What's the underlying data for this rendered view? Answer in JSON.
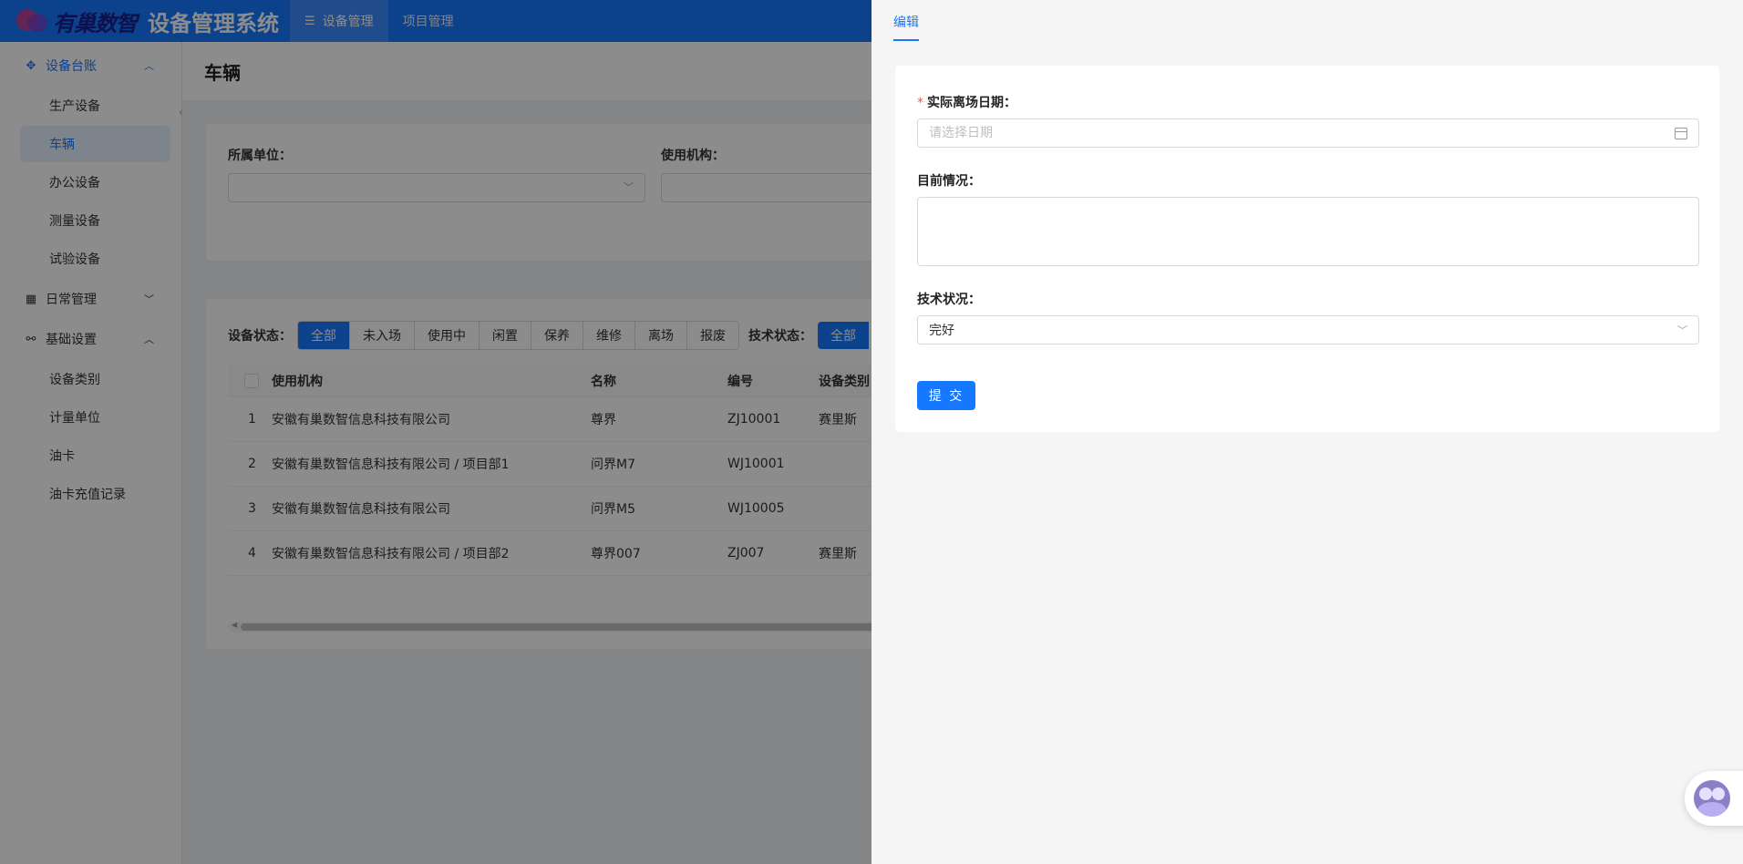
{
  "header": {
    "logo_text": "有巢数智",
    "app_title": "设备管理系统",
    "tabs": [
      {
        "label": "设备管理",
        "icon": "list-icon",
        "active": true
      },
      {
        "label": "项目管理",
        "active": false
      }
    ]
  },
  "sidebar": {
    "groups": [
      {
        "label": "设备台账",
        "icon": "cluster-icon",
        "expanded": true,
        "items": [
          {
            "label": "生产设备"
          },
          {
            "label": "车辆",
            "active": true
          },
          {
            "label": "办公设备"
          },
          {
            "label": "测量设备"
          },
          {
            "label": "试验设备"
          }
        ]
      },
      {
        "label": "日常管理",
        "icon": "dashboard-icon",
        "expanded": false
      },
      {
        "label": "基础设置",
        "icon": "link-icon",
        "expanded": true,
        "items": [
          {
            "label": "设备类别"
          },
          {
            "label": "计量单位"
          },
          {
            "label": "油卡"
          },
          {
            "label": "油卡充值记录"
          }
        ]
      }
    ]
  },
  "page": {
    "title": "车辆",
    "filters": {
      "unit_label": "所属单位：",
      "org_label": "使用机构："
    },
    "status_label": "设备状态：",
    "status_options": [
      "全部",
      "未入场",
      "使用中",
      "闲置",
      "保养",
      "维修",
      "离场",
      "报废"
    ],
    "tech_label": "技术状态：",
    "tech_first_option": "全部",
    "table": {
      "columns": [
        "使用机构",
        "名称",
        "编号",
        "设备类别"
      ],
      "rows": [
        {
          "idx": "1",
          "org": "安徽有巢数智信息科技有限公司",
          "name": "尊界",
          "code": "ZJ10001",
          "type": "赛里斯"
        },
        {
          "idx": "2",
          "org": "安徽有巢数智信息科技有限公司 / 项目部1",
          "name": "问界M7",
          "code": "WJ10001",
          "type": ""
        },
        {
          "idx": "3",
          "org": "安徽有巢数智信息科技有限公司",
          "name": "问界M5",
          "code": "WJ10005",
          "type": ""
        },
        {
          "idx": "4",
          "org": "安徽有巢数智信息科技有限公司 / 项目部2",
          "name": "尊界007",
          "code": "ZJ007",
          "type": "赛里斯"
        }
      ]
    }
  },
  "drawer": {
    "tab_label": "编辑",
    "form": {
      "date_label": "实际离场日期：",
      "date_required": "*",
      "date_placeholder": "请选择日期",
      "date_value": "",
      "situation_label": "目前情况：",
      "situation_value": "",
      "tech_label": "技术状况：",
      "tech_value": "完好",
      "submit_label": "提 交"
    }
  },
  "colors": {
    "primary": "#1677ff",
    "mask": "rgba(0,0,0,0.45)",
    "required": "#ff4d4f"
  }
}
